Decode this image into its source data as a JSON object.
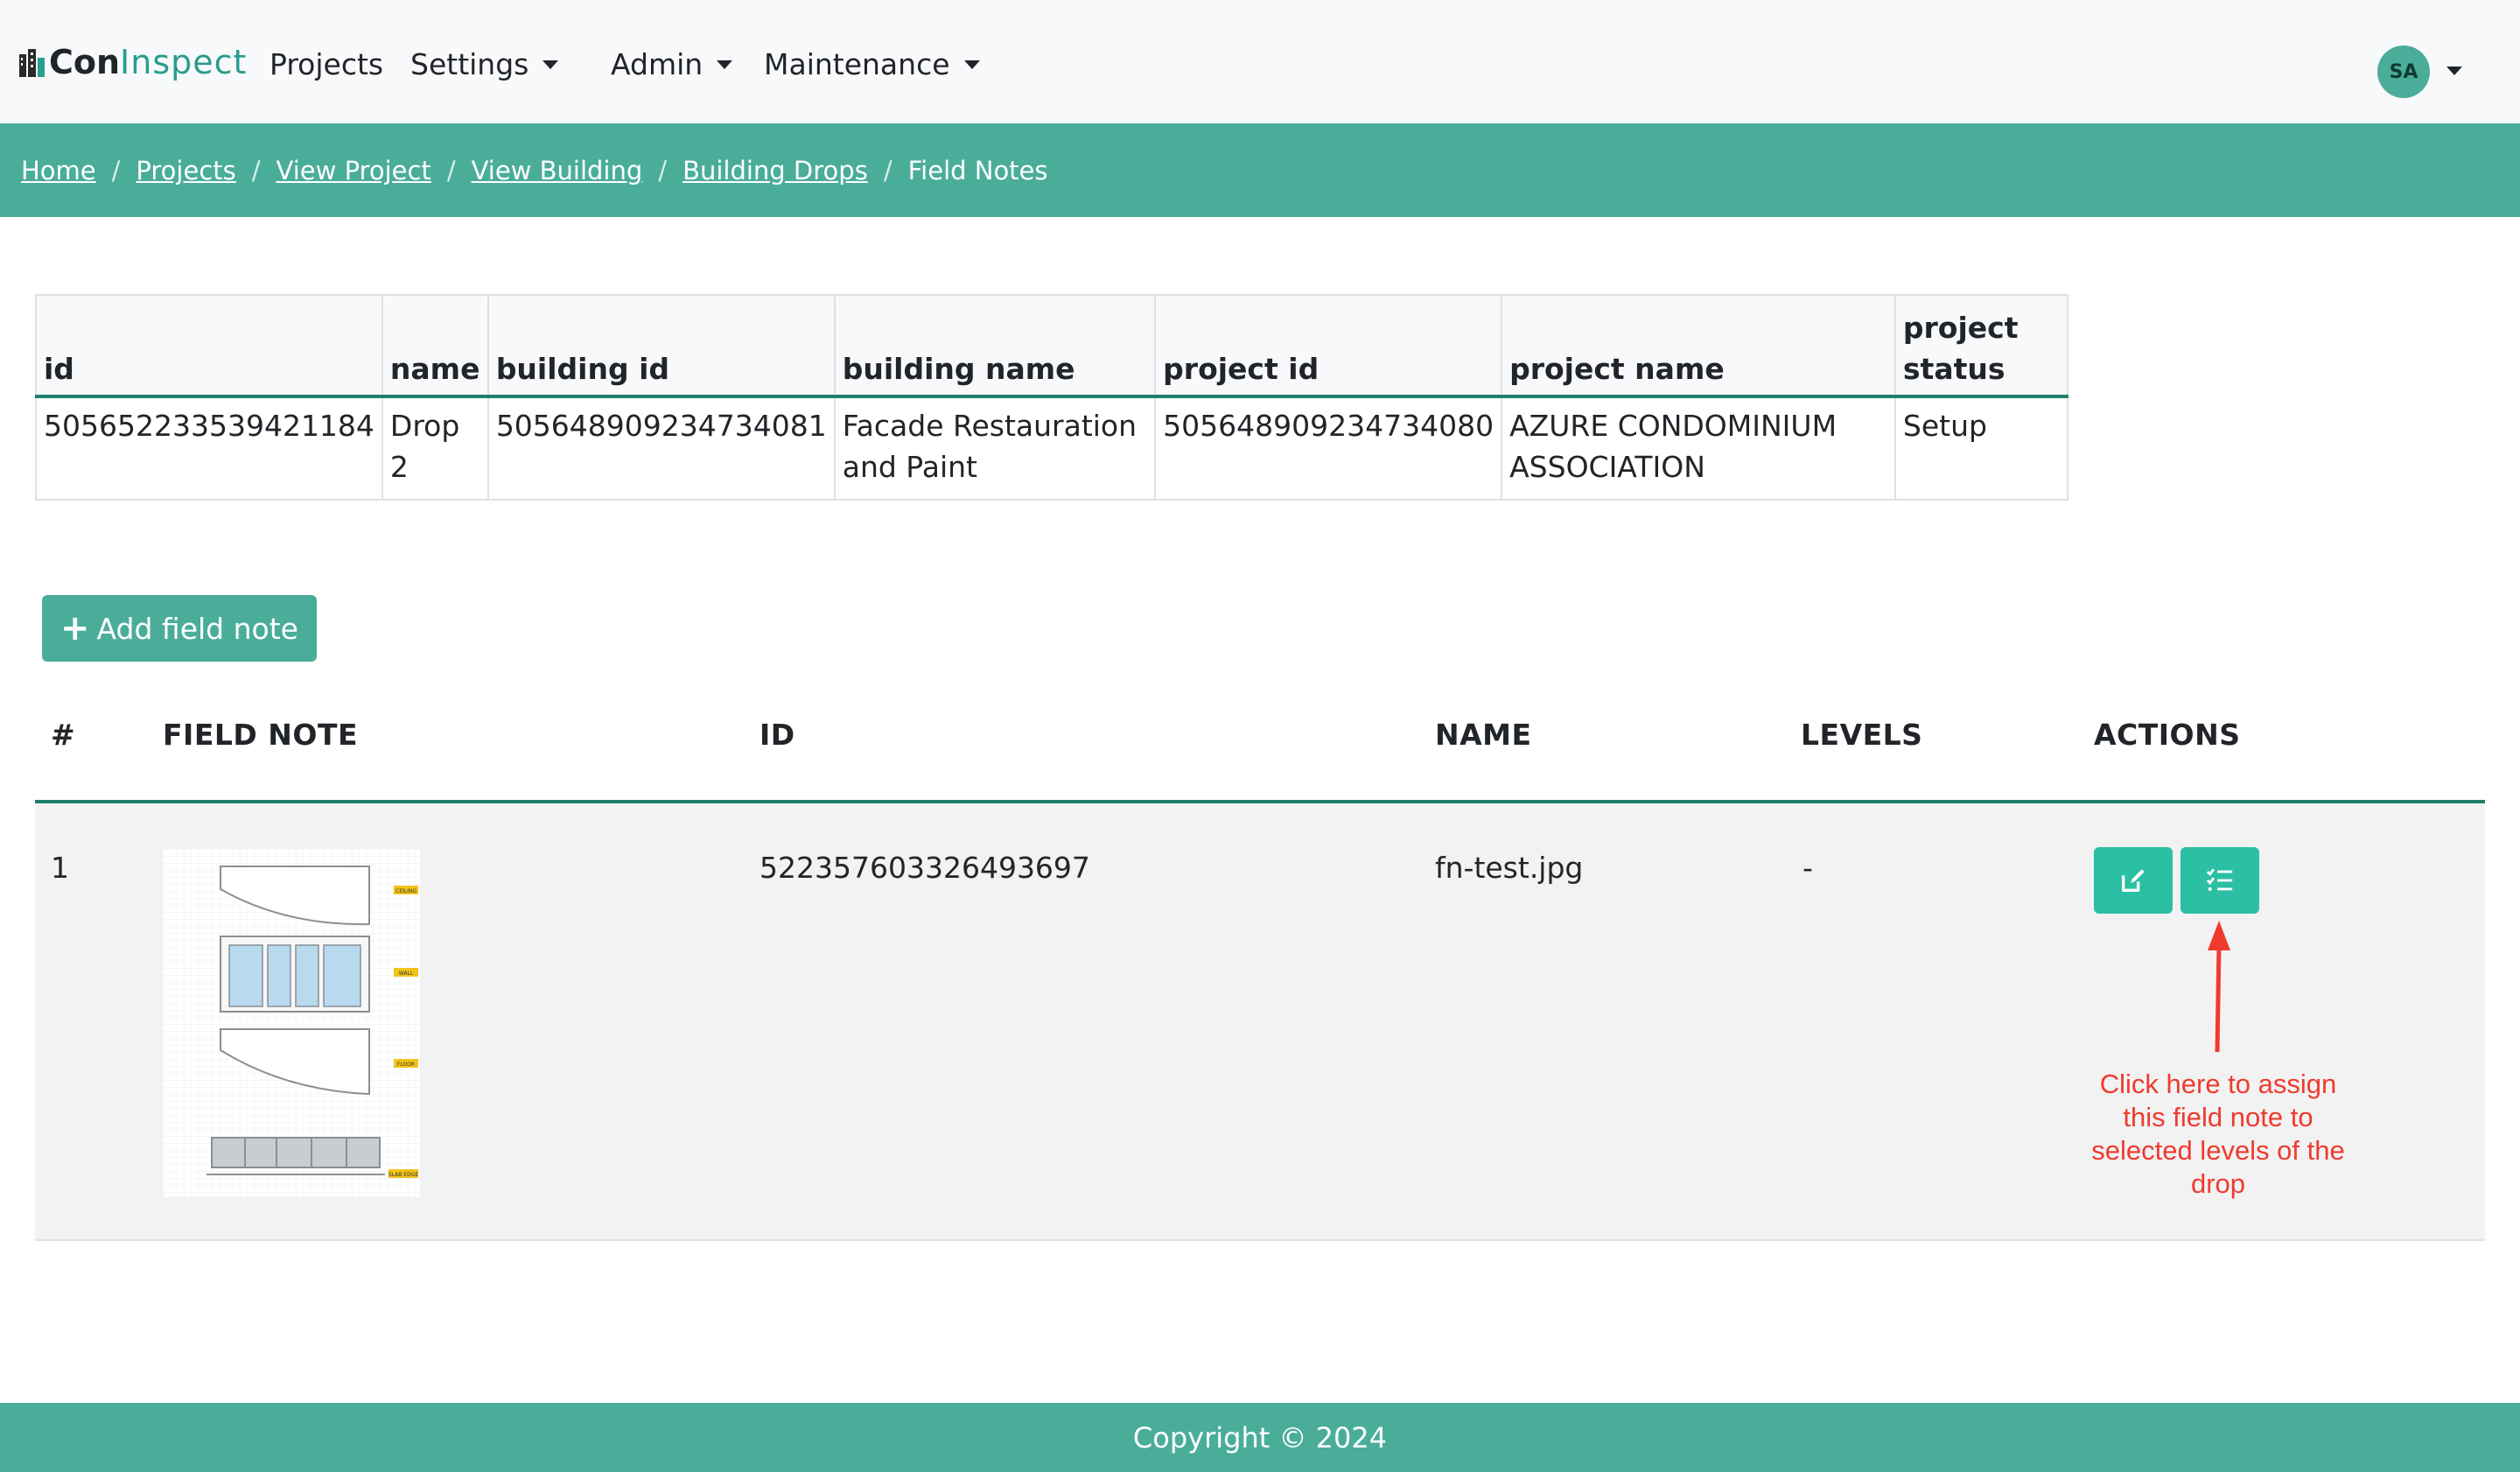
{
  "brand": {
    "part1": "Con",
    "part2": "Inspect"
  },
  "nav": {
    "projects": "Projects",
    "settings": "Settings",
    "admin": "Admin",
    "maintenance": "Maintenance",
    "user_initials": "SA"
  },
  "breadcrumb": {
    "items": [
      "Home",
      "Projects",
      "View Project",
      "View Building",
      "Building Drops"
    ],
    "current": "Field Notes",
    "separator": "/"
  },
  "drop_info": {
    "headers": [
      "id",
      "name",
      "building id",
      "building name",
      "project id",
      "project name",
      "project status"
    ],
    "row": {
      "id": "505652233539421184",
      "name": "Drop 2",
      "building_id": "505648909234734081",
      "building_name": "Facade Restauration and Paint",
      "project_id": "505648909234734080",
      "project_name": "AZURE CONDOMINIUM ASSOCIATION",
      "project_status": "Setup"
    }
  },
  "add_button": {
    "icon": "plus-icon",
    "label": "Add field note"
  },
  "field_notes": {
    "headers": {
      "num": "#",
      "field_note": "FIELD NOTE",
      "id": "ID",
      "name": "NAME",
      "levels": "LEVELS",
      "actions": "ACTIONS"
    },
    "rows": [
      {
        "num": "1",
        "id": "522357603326493697",
        "name": "fn-test.jpg",
        "levels": "-",
        "thumb_labels": [
          "CEILING",
          "WALL",
          "FLOOR",
          "SLAB EDGE"
        ]
      }
    ]
  },
  "annotation": {
    "text": "Click here to assign this field note to selected levels of the drop",
    "color": "#f03a2e"
  },
  "footer": {
    "text": "Copyright © 2024"
  },
  "colors": {
    "accent": "#4aad9a",
    "action_button": "#2bbfa4",
    "header_rule": "#1e7f6e"
  }
}
